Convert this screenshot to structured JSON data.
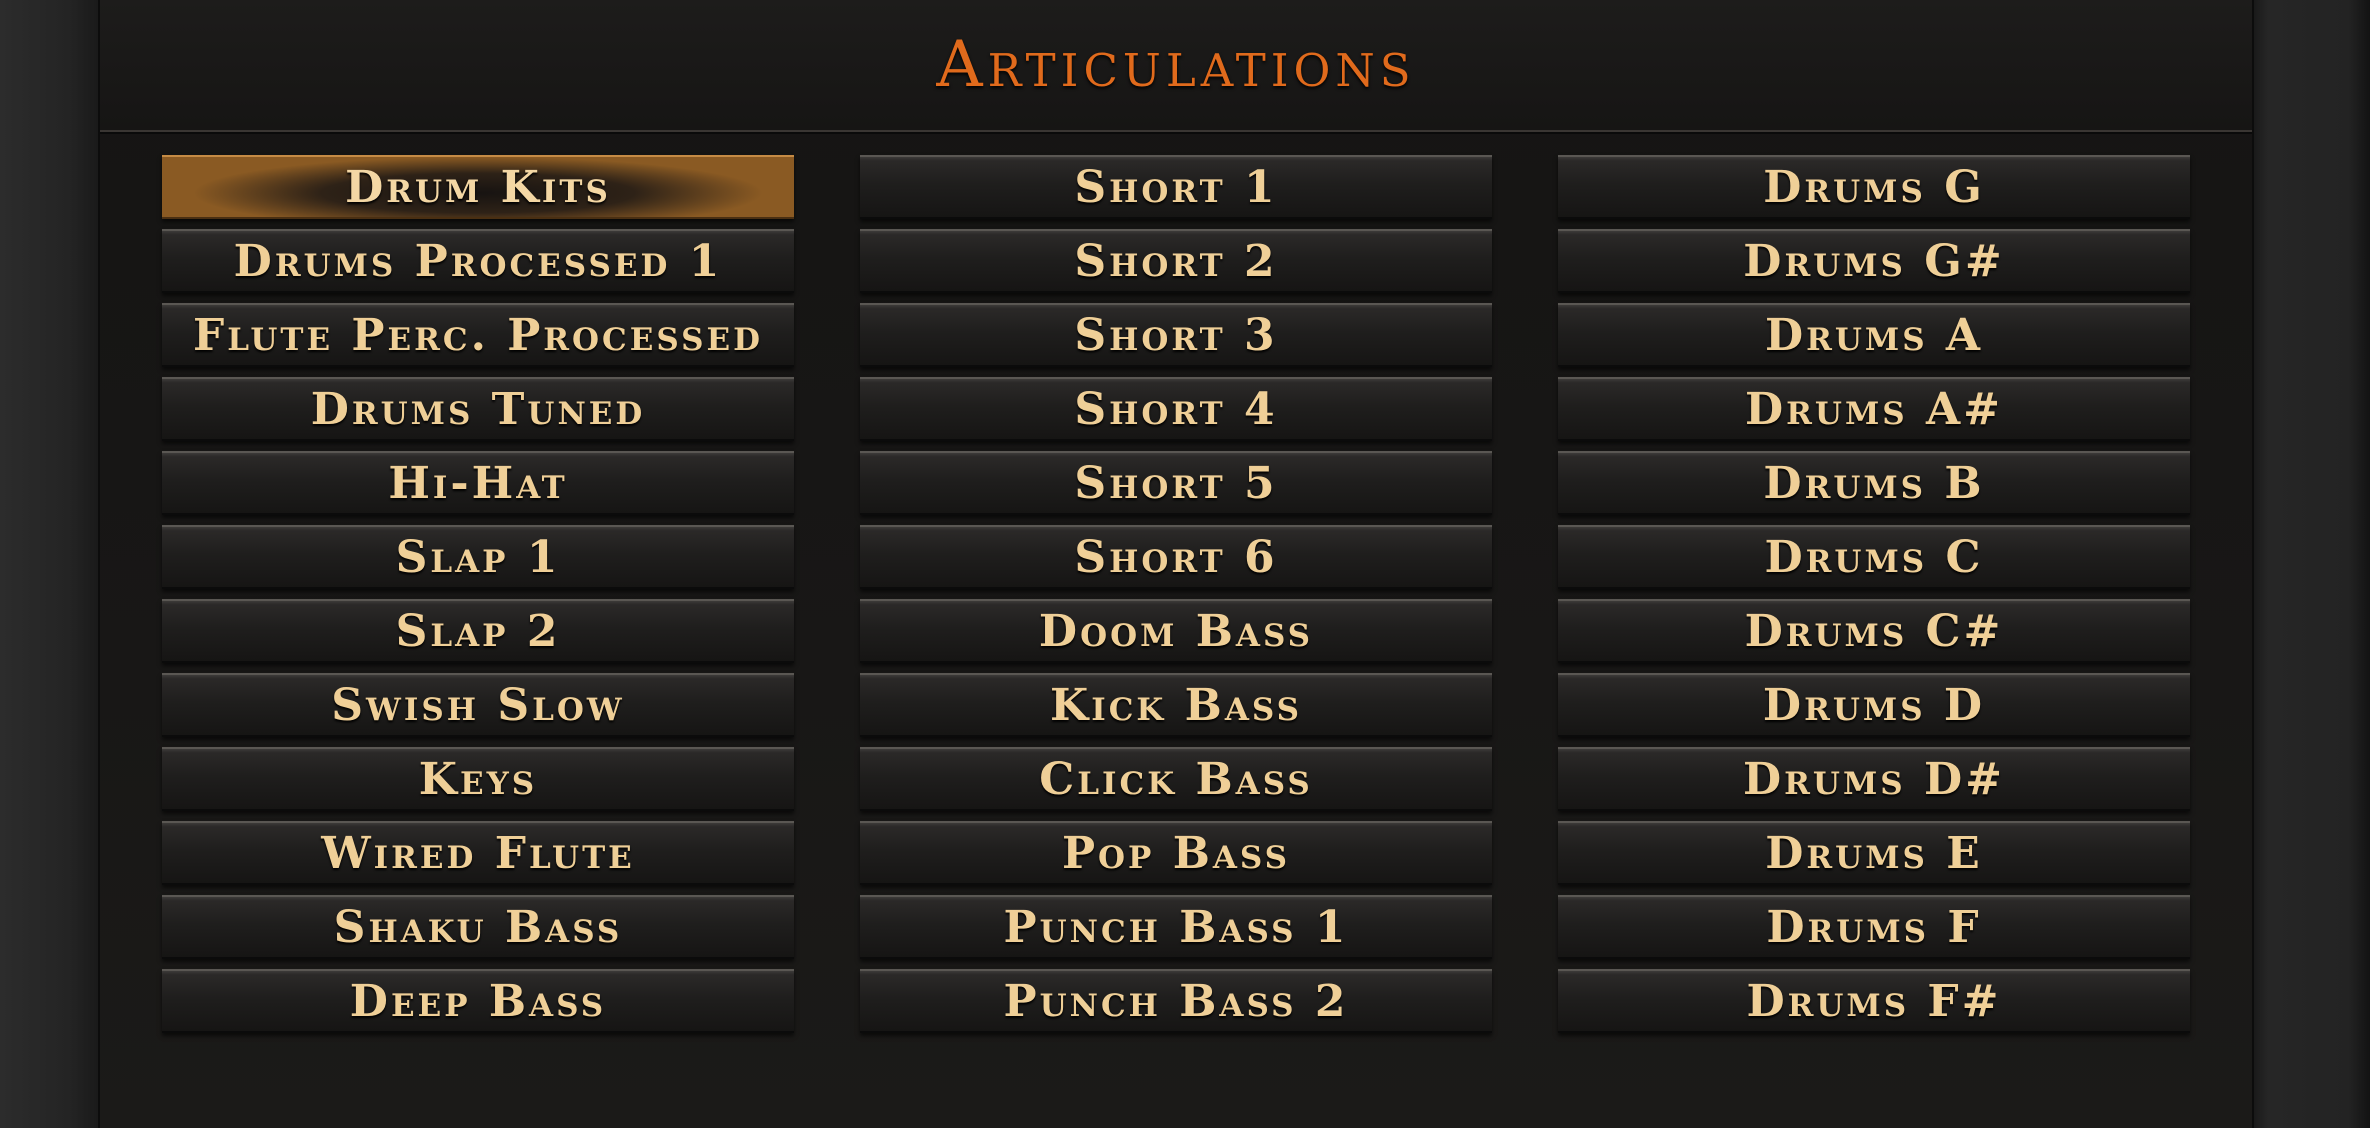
{
  "title": "Articulations",
  "selected": "Drum Kits",
  "columns": [
    [
      "Drum Kits",
      "Drums Processed 1",
      "Flute Perc. Processed",
      "Drums Tuned",
      "Hi-Hat",
      "Slap 1",
      "Slap 2",
      "Swish Slow",
      "Keys",
      "Wired Flute",
      "Shaku Bass",
      "Deep Bass"
    ],
    [
      "Short 1",
      "Short 2",
      "Short 3",
      "Short 4",
      "Short 5",
      "Short 6",
      "Doom Bass",
      "Kick Bass",
      "Click Bass",
      "Pop Bass",
      "Punch Bass 1",
      "Punch Bass 2"
    ],
    [
      "Drums G",
      "Drums G#",
      "Drums A",
      "Drums A#",
      "Drums B",
      "Drums C",
      "Drums C#",
      "Drums D",
      "Drums D#",
      "Drums E",
      "Drums F",
      "Drums F#"
    ]
  ],
  "colors": {
    "title": "#e06a1c",
    "button_text": "#efcf97",
    "selected_glow": "#8a5a23"
  }
}
